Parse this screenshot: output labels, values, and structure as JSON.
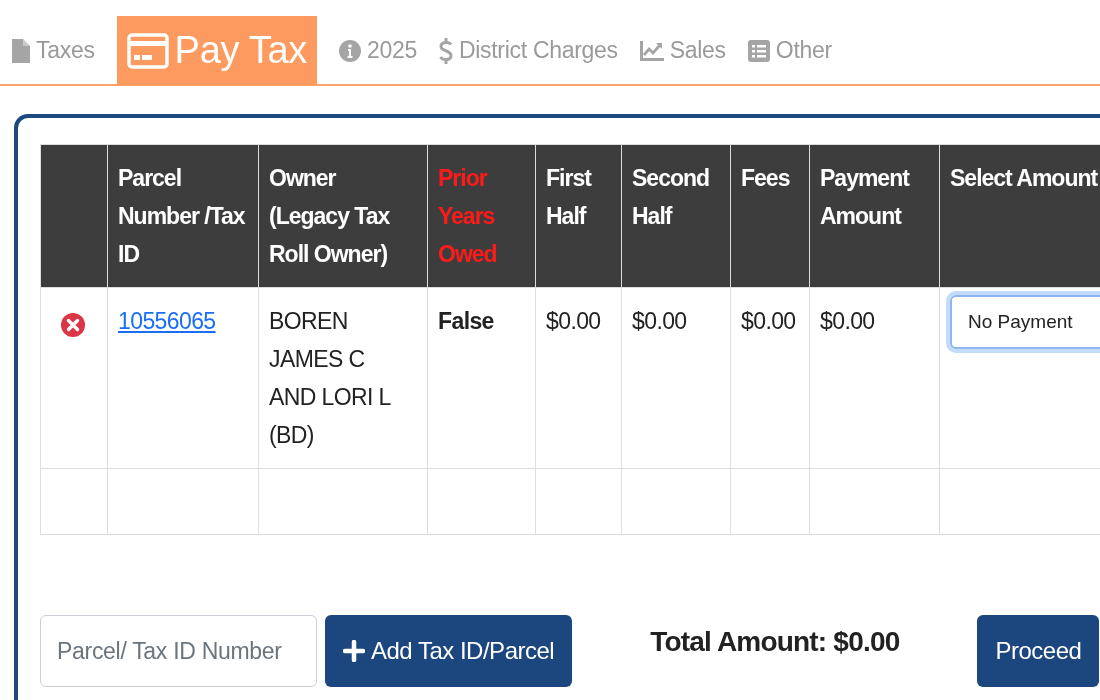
{
  "tabs": [
    {
      "label": "Taxes",
      "selected": false
    },
    {
      "label": "Pay Tax",
      "selected": true
    },
    {
      "label": "2025",
      "selected": false
    },
    {
      "label": "District Charges",
      "selected": false
    },
    {
      "label": "Sales",
      "selected": false
    },
    {
      "label": "Other",
      "selected": false
    }
  ],
  "table": {
    "columns": [
      {
        "label": "Parcel Number /Tax ID",
        "alert": false
      },
      {
        "label": "Owner (Legacy Tax Roll Owner)",
        "alert": false
      },
      {
        "label": "Prior Years Owed",
        "alert": true
      },
      {
        "label": "First Half",
        "alert": false
      },
      {
        "label": "Second Half",
        "alert": false
      },
      {
        "label": "Fees",
        "alert": false
      },
      {
        "label": "Payment Amount",
        "alert": false
      },
      {
        "label": "Select Amount",
        "alert": false
      }
    ],
    "rows": [
      {
        "parcel": "10556065",
        "owner": "BOREN JAMES C AND LORI L (BD)",
        "prior_years_owed": "False",
        "first_half": "$0.00",
        "second_half": "$0.00",
        "fees": "$0.00",
        "payment_amount": "$0.00",
        "select_amount": "No Payment"
      }
    ]
  },
  "parcel_field": {
    "placeholder": "Parcel/ Tax ID Number"
  },
  "add_button": "Add Tax ID/Parcel",
  "total": "Total Amount: $0.00",
  "proceed_button": "Proceed"
}
